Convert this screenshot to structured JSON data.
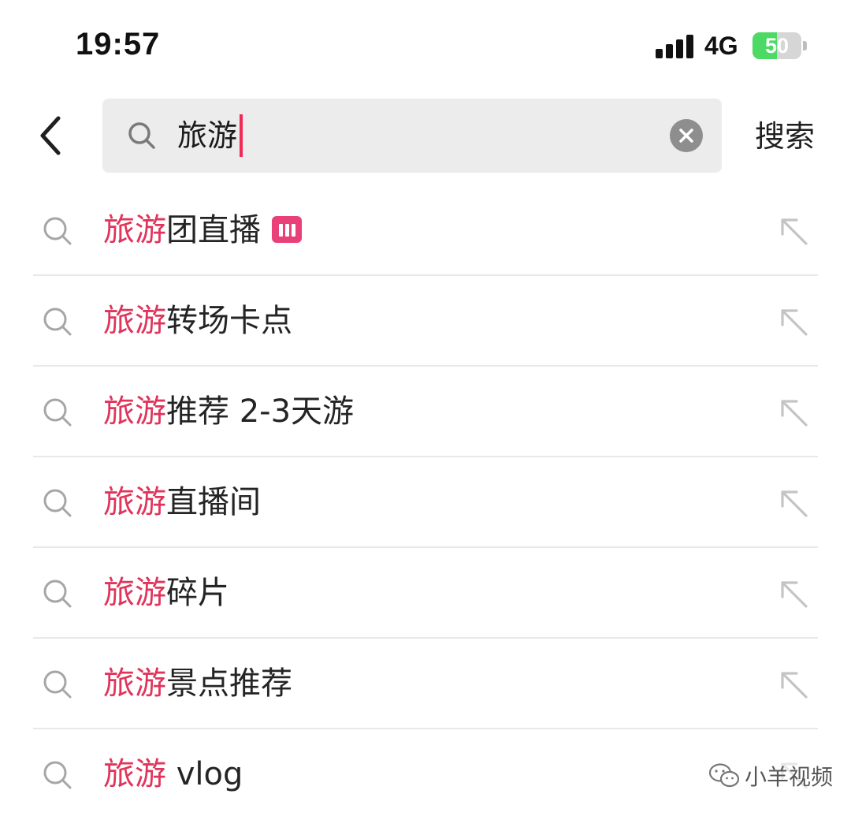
{
  "status_bar": {
    "time": "19:57",
    "network": "4G",
    "battery": "50",
    "battery_level": 0.5,
    "battery_color": "#4cd964",
    "charging": true
  },
  "search": {
    "query": "旅游",
    "search_button_label": "搜索",
    "icons": {
      "back": "chevron-left-icon",
      "search": "search-icon",
      "clear": "clear-icon"
    }
  },
  "accent_color": "#e0345b",
  "suggestions": [
    {
      "highlight": "旅游",
      "rest": "团直播",
      "badge": "live-icon"
    },
    {
      "highlight": "旅游",
      "rest": "转场卡点"
    },
    {
      "highlight": "旅游",
      "rest": "推荐 2-3天游"
    },
    {
      "highlight": "旅游",
      "rest": "直播间"
    },
    {
      "highlight": "旅游",
      "rest": "碎片"
    },
    {
      "highlight": "旅游",
      "rest": "景点推荐"
    },
    {
      "highlight": "旅游",
      "rest": " vlog"
    }
  ],
  "watermark": {
    "text": "小羊视频",
    "icon": "wechat-icon"
  }
}
